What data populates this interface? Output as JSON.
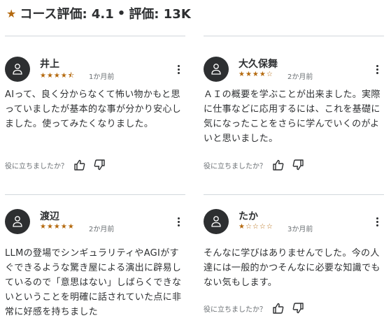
{
  "header": {
    "star_icon": "star-icon",
    "course_rating_label": "コース評価: 4.1",
    "separator": "•",
    "rating_count_label": "評価: 13K"
  },
  "helpful_prompt": "役に立ちましたか？",
  "reviews": [
    {
      "name": "井上",
      "rating": 4.5,
      "stars": "★★★★⯪",
      "time": "1か月前",
      "text": "AIって、良く分からなくて怖い物かもと思っていましたが基本的な事が分かり安心しました。使ってみたくなりました。"
    },
    {
      "name": "大久保舞",
      "rating": 4,
      "stars": "★★★★☆",
      "time": "2か月前",
      "text": "ＡＩの概要を学ぶことが出来ました。実際に仕事などに応用するには、これを基礎に気になったことをさらに学んでいくのがよいと思いました。"
    },
    {
      "name": "渡辺",
      "rating": 5,
      "stars": "★★★★★",
      "time": "2か月前",
      "text": "LLMの登場でシンギュラリティやAGIがすぐできるような驚き屋による演出に辟易しているので「意思はない」しばらくできないということを明確に話されていた点に非常に好感を持ちました"
    },
    {
      "name": "たか",
      "rating": 1,
      "stars": "★☆☆☆☆",
      "time": "3か月前",
      "text": "そんなに学びはありませんでした。今の人達には一般的かつそんなに必要な知識でもない気もします。"
    }
  ]
}
